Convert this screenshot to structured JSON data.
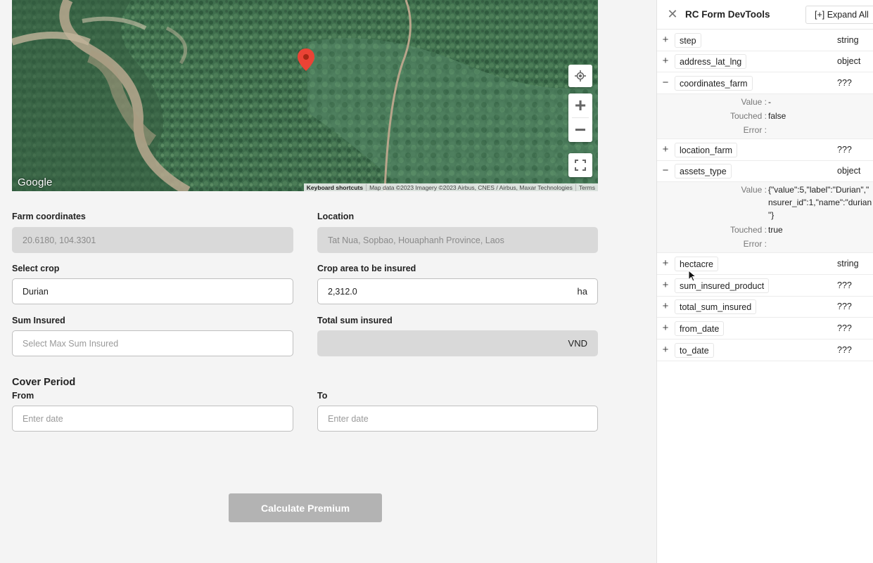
{
  "map": {
    "logo": "Google",
    "attribution": {
      "shortcuts": "Keyboard shortcuts",
      "data": "Map data ©2023 Imagery ©2023 Airbus, CNES / Airbus, Maxar Technologies",
      "terms": "Terms"
    },
    "zoom_in": "+",
    "zoom_out": "−"
  },
  "form": {
    "farm_coordinates": {
      "label": "Farm coordinates",
      "value": "20.6180, 104.3301"
    },
    "location": {
      "label": "Location",
      "value": "Tat Nua, Sopbao, Houaphanh Province, Laos"
    },
    "select_crop": {
      "label": "Select crop",
      "value": "Durian"
    },
    "crop_area": {
      "label": "Crop area to be insured",
      "value": "2,312.0",
      "unit": "ha"
    },
    "sum_insured": {
      "label": "Sum Insured",
      "placeholder": "Select Max Sum Insured"
    },
    "total_sum_insured": {
      "label": "Total sum insured",
      "value": "",
      "unit": "VND"
    },
    "cover_period": {
      "title": "Cover Period",
      "from": {
        "label": "From",
        "placeholder": "Enter date"
      },
      "to": {
        "label": "To",
        "placeholder": "Enter date"
      }
    },
    "calculate_button": "Calculate Premium"
  },
  "devtools": {
    "title": "RC Form DevTools",
    "expand_all": "[+] Expand All",
    "close": "✕",
    "value_label": "Value",
    "touched_label": "Touched",
    "error_label": "Error",
    "fields": [
      {
        "name": "step",
        "type": "string",
        "expanded": false,
        "toggle": "+"
      },
      {
        "name": "address_lat_lng",
        "type": "object",
        "expanded": false,
        "toggle": "+"
      },
      {
        "name": "coordinates_farm",
        "type": "???",
        "expanded": true,
        "toggle": "−",
        "value": "-",
        "touched": "false",
        "error": ""
      },
      {
        "name": "location_farm",
        "type": "???",
        "expanded": false,
        "toggle": "+"
      },
      {
        "name": "assets_type",
        "type": "object",
        "expanded": true,
        "toggle": "−",
        "value_lines": [
          "{\"value\":5,\"label\":\"Durian\",\"",
          "nsurer_id\":1,\"name\":\"durian",
          "\"}"
        ],
        "touched": "true",
        "error": ""
      },
      {
        "name": "hectacre",
        "type": "string",
        "expanded": false,
        "toggle": "+"
      },
      {
        "name": "sum_insured_product",
        "type": "???",
        "expanded": false,
        "toggle": "+"
      },
      {
        "name": "total_sum_insured",
        "type": "???",
        "expanded": false,
        "toggle": "+"
      },
      {
        "name": "from_date",
        "type": "???",
        "expanded": false,
        "toggle": "+"
      },
      {
        "name": "to_date",
        "type": "???",
        "expanded": false,
        "toggle": "+"
      }
    ]
  }
}
